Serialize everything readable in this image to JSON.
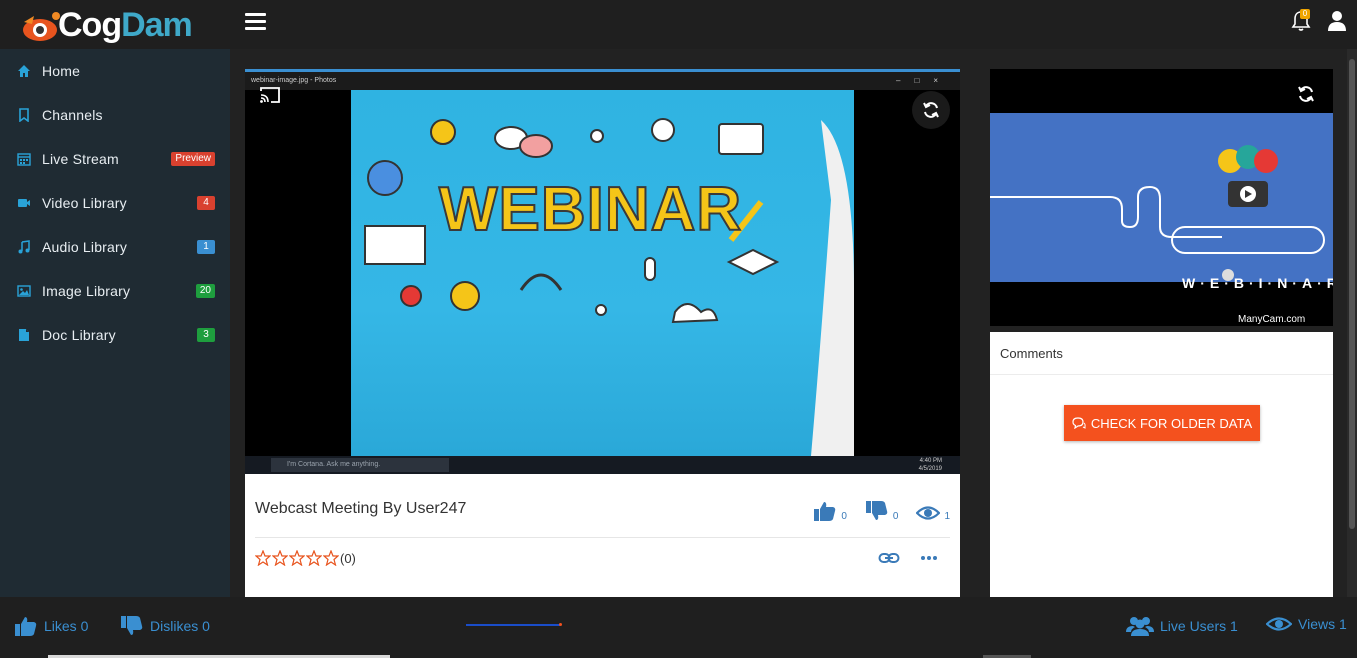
{
  "brand": {
    "cog": "Cog",
    "dam": "Dam",
    "accent": "#3fa9c9"
  },
  "header": {
    "notification_count": "0"
  },
  "sidebar": {
    "items": [
      {
        "label": "Home",
        "icon": "home-icon",
        "badge": "",
        "badge_color": ""
      },
      {
        "label": "Channels",
        "icon": "bookmark-icon",
        "badge": "",
        "badge_color": ""
      },
      {
        "label": "Live Stream",
        "icon": "calendar-icon",
        "badge": "Preview",
        "badge_color": "#d9412f"
      },
      {
        "label": "Video Library",
        "icon": "video-camera-icon",
        "badge": "4",
        "badge_color": "#d9412f"
      },
      {
        "label": "Audio Library",
        "icon": "music-icon",
        "badge": "1",
        "badge_color": "#3a8fd1"
      },
      {
        "label": "Image Library",
        "icon": "image-icon",
        "badge": "20",
        "badge_color": "#1e9e3e"
      },
      {
        "label": "Doc Library",
        "icon": "document-icon",
        "badge": "3",
        "badge_color": "#1e9e3e"
      }
    ]
  },
  "player": {
    "window_title": "webinar-image.jpg - Photos",
    "overlay_text": "WEBINAR",
    "cortana_placeholder": "I'm Cortana. Ask me anything.",
    "clock_time": "4:40 PM",
    "clock_date": "4/5/2019"
  },
  "video_meta": {
    "title": "Webcast Meeting By User247",
    "likes": "0",
    "dislikes": "0",
    "views": "1",
    "rating_text": "(0)"
  },
  "mini_player": {
    "overlay_text": "W·E·B·I·N·A·R",
    "brand": "ManyCam.com"
  },
  "comments": {
    "header": "Comments",
    "older_button": "CHECK FOR OLDER DATA"
  },
  "footer": {
    "likes": "Likes 0",
    "dislikes": "Dislikes 0",
    "live_users": "Live Users 1",
    "views": "Views 1",
    "progress": 0.98
  }
}
